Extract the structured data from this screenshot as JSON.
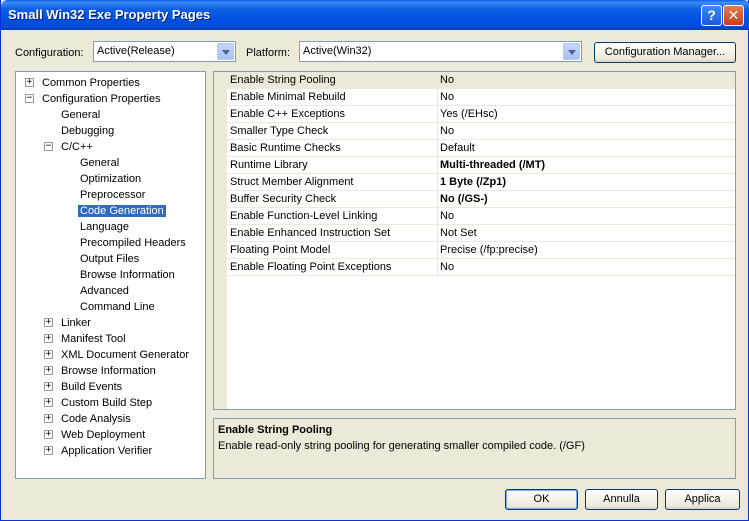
{
  "window": {
    "title": "Small Win32 Exe Property Pages",
    "help_glyph": "?",
    "close_glyph": "✕"
  },
  "toolbar": {
    "configuration_label": "Configuration:",
    "configuration_value": "Active(Release)",
    "platform_label": "Platform:",
    "platform_value": "Active(Win32)",
    "config_manager_label": "Configuration Manager..."
  },
  "tree": {
    "items": [
      {
        "label": "Common Properties",
        "expander": "+"
      },
      {
        "label": "Configuration Properties",
        "expander": "−"
      },
      {
        "label": "General"
      },
      {
        "label": "Debugging"
      },
      {
        "label": "C/C++",
        "expander": "−"
      },
      {
        "label": "General"
      },
      {
        "label": "Optimization"
      },
      {
        "label": "Preprocessor"
      },
      {
        "label": "Code Generation",
        "selected": true
      },
      {
        "label": "Language"
      },
      {
        "label": "Precompiled Headers"
      },
      {
        "label": "Output Files"
      },
      {
        "label": "Browse Information"
      },
      {
        "label": "Advanced"
      },
      {
        "label": "Command Line"
      },
      {
        "label": "Linker",
        "expander": "+"
      },
      {
        "label": "Manifest Tool",
        "expander": "+"
      },
      {
        "label": "XML Document Generator",
        "expander": "+"
      },
      {
        "label": "Browse Information",
        "expander": "+"
      },
      {
        "label": "Build Events",
        "expander": "+"
      },
      {
        "label": "Custom Build Step",
        "expander": "+"
      },
      {
        "label": "Code Analysis",
        "expander": "+"
      },
      {
        "label": "Web Deployment",
        "expander": "+"
      },
      {
        "label": "Application Verifier",
        "expander": "+"
      }
    ]
  },
  "properties": [
    {
      "name": "Enable String Pooling",
      "value": "No"
    },
    {
      "name": "Enable Minimal Rebuild",
      "value": "No"
    },
    {
      "name": "Enable C++ Exceptions",
      "value": "Yes (/EHsc)"
    },
    {
      "name": "Smaller Type Check",
      "value": "No"
    },
    {
      "name": "Basic Runtime Checks",
      "value": "Default"
    },
    {
      "name": "Runtime Library",
      "value": "Multi-threaded (/MT)",
      "bold": true
    },
    {
      "name": "Struct Member Alignment",
      "value": "1 Byte (/Zp1)",
      "bold": true
    },
    {
      "name": "Buffer Security Check",
      "value": "No (/GS-)",
      "bold": true
    },
    {
      "name": "Enable Function-Level Linking",
      "value": "No"
    },
    {
      "name": "Enable Enhanced Instruction Set",
      "value": "Not Set"
    },
    {
      "name": "Floating Point Model",
      "value": "Precise (/fp:precise)"
    },
    {
      "name": "Enable Floating Point Exceptions",
      "value": "No"
    }
  ],
  "description": {
    "title": "Enable String Pooling",
    "text": "Enable read-only string pooling for generating smaller compiled code.     (/GF)"
  },
  "buttons": {
    "ok": "OK",
    "cancel": "Annulla",
    "apply": "Applica"
  }
}
